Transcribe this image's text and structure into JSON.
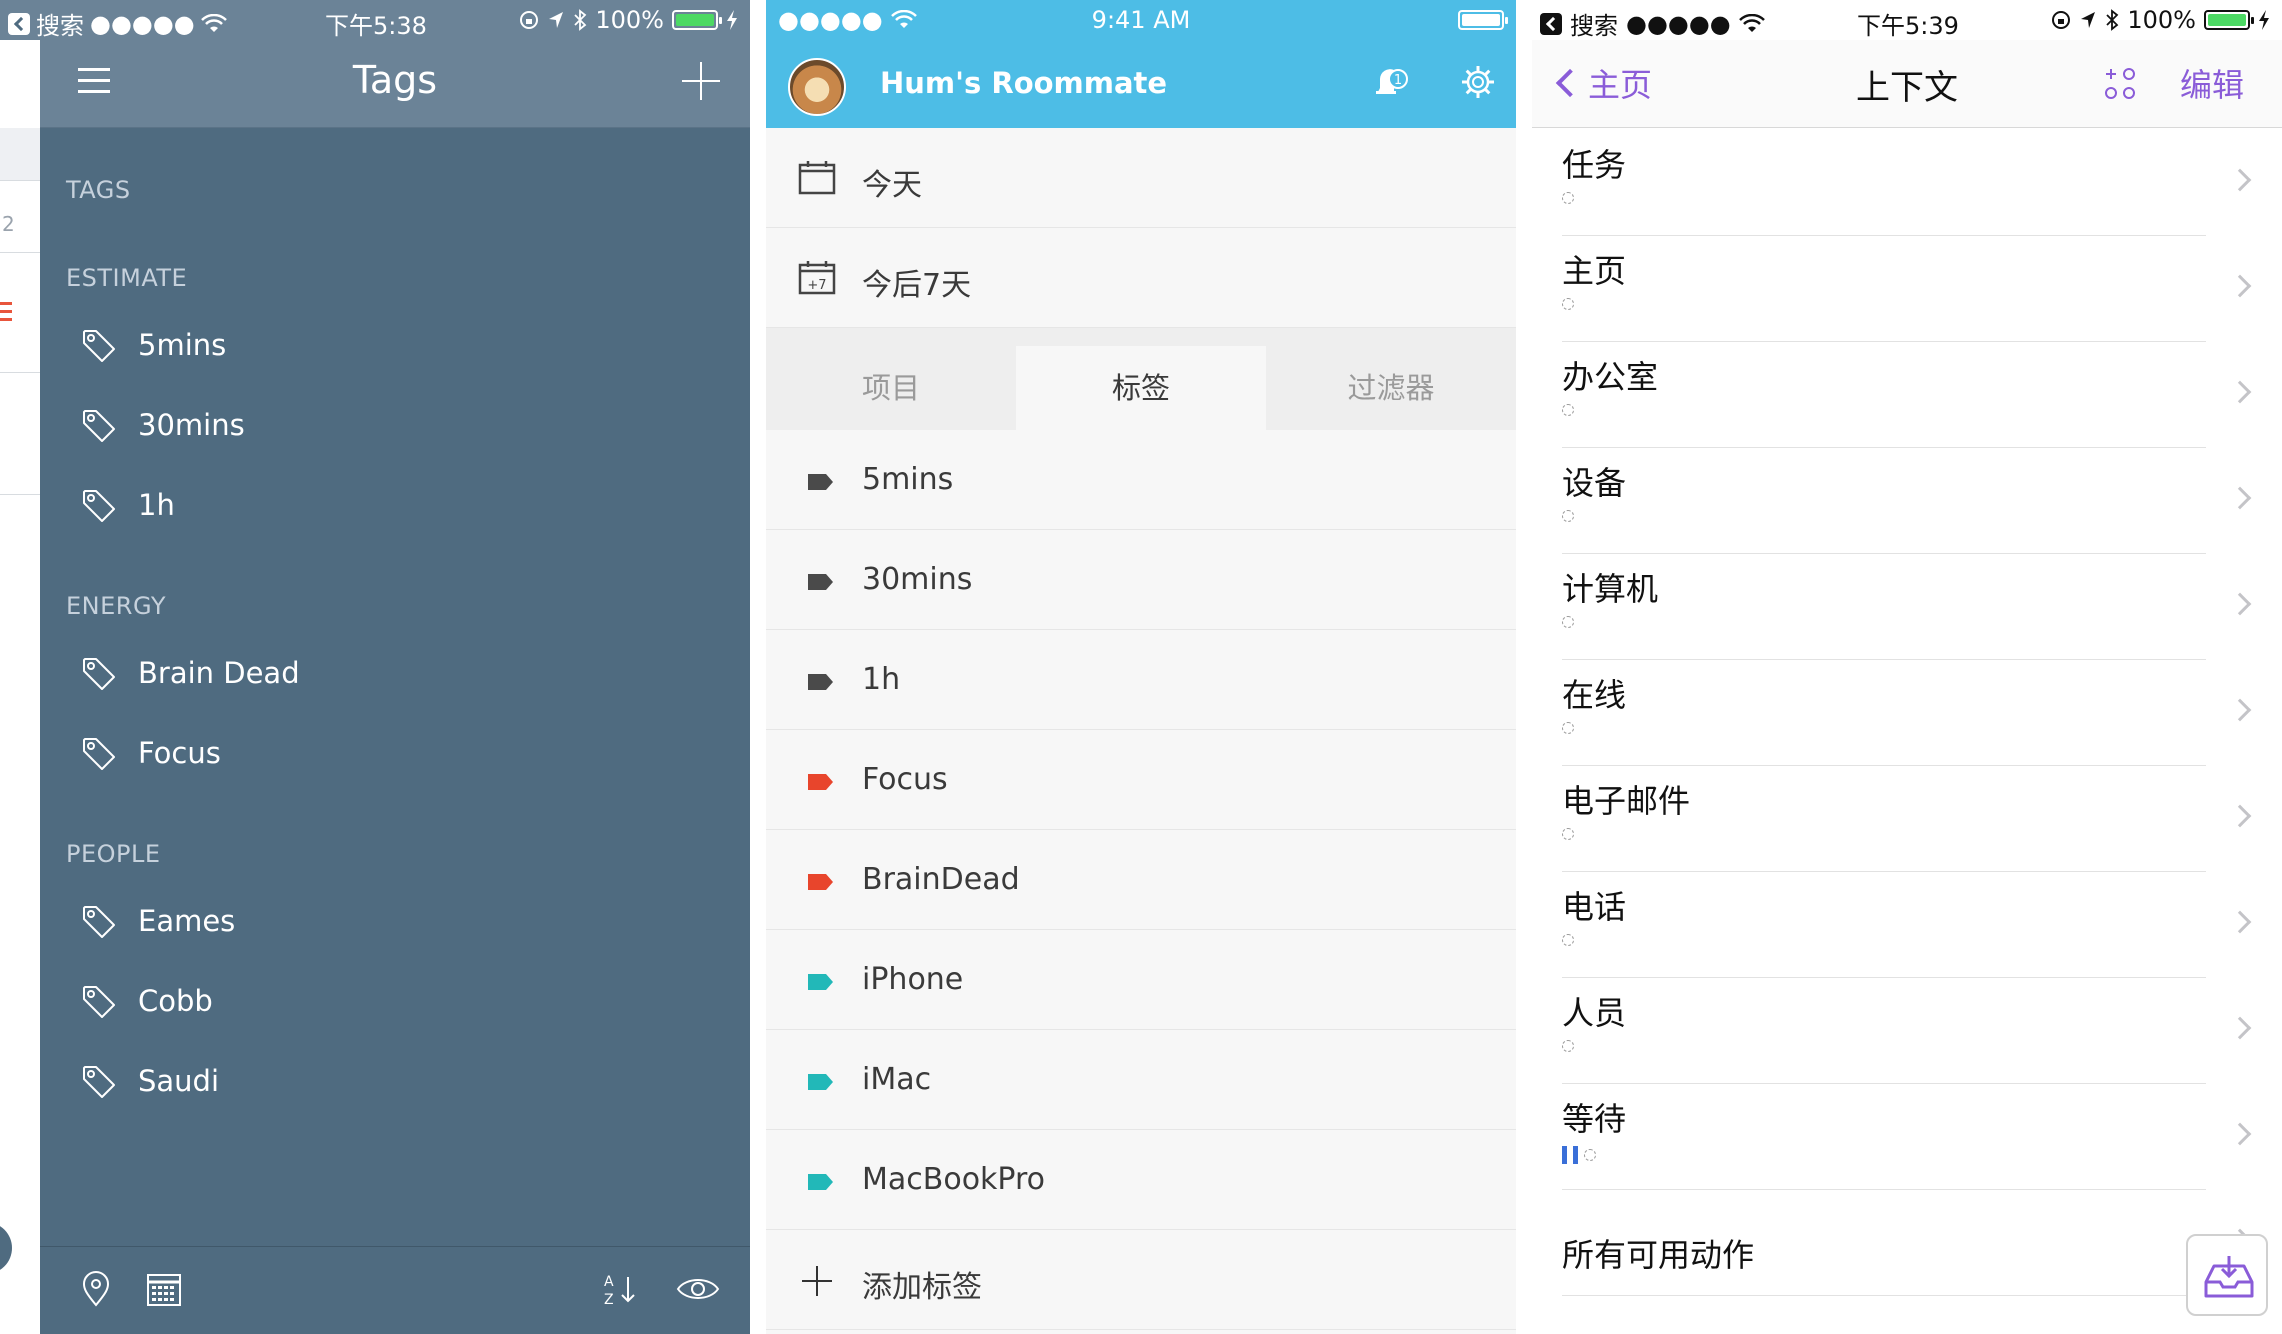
{
  "panel_tags": {
    "status": {
      "carrier": "搜索",
      "signal": "●●●●●",
      "time": "下午5:38",
      "battery": "100%"
    },
    "title": "Tags",
    "strip_number": "2",
    "sections": [
      {
        "header": "TAGS",
        "items": []
      },
      {
        "header": "ESTIMATE",
        "items": [
          "5mins",
          "30mins",
          "1h"
        ]
      },
      {
        "header": "ENERGY",
        "items": [
          "Brain Dead",
          "Focus"
        ]
      },
      {
        "header": "PEOPLE",
        "items": [
          "Eames",
          "Cobb",
          "Saudi"
        ]
      }
    ],
    "toolbar_icons": [
      "location-pin-icon",
      "calendar-icon",
      "sort-az-icon",
      "eye-icon"
    ]
  },
  "panel_roommate": {
    "status": {
      "signal": "●●●●●",
      "time": "9:41 AM"
    },
    "user": "Hum's Roommate",
    "notification_count": "1",
    "today": "今天",
    "next7": "今后7天",
    "next7_badge": "+7",
    "tabs": [
      "项目",
      "标签",
      "过滤器"
    ],
    "active_tab": 1,
    "tags": [
      {
        "label": "5mins",
        "color": "#4a4a4a"
      },
      {
        "label": "30mins",
        "color": "#4a4a4a"
      },
      {
        "label": "1h",
        "color": "#4a4a4a"
      },
      {
        "label": "Focus",
        "color": "#e8452c"
      },
      {
        "label": "BrainDead",
        "color": "#e8452c"
      },
      {
        "label": "iPhone",
        "color": "#22b8b8"
      },
      {
        "label": "iMac",
        "color": "#22b8b8"
      },
      {
        "label": "MacBookPro",
        "color": "#22b8b8"
      }
    ],
    "add_tag": "添加标签"
  },
  "panel_context": {
    "status": {
      "carrier": "搜索",
      "signal": "●●●●●",
      "time": "下午5:39",
      "battery": "100%"
    },
    "back_label": "主页",
    "title": "上下文",
    "edit_label": "编辑",
    "accent": "#8a5cd8",
    "items": [
      "任务",
      "主页",
      "办公室",
      "设备",
      "计算机",
      "在线",
      "电子邮件",
      "电话",
      "人员",
      "等待",
      "所有可用动作"
    ]
  }
}
